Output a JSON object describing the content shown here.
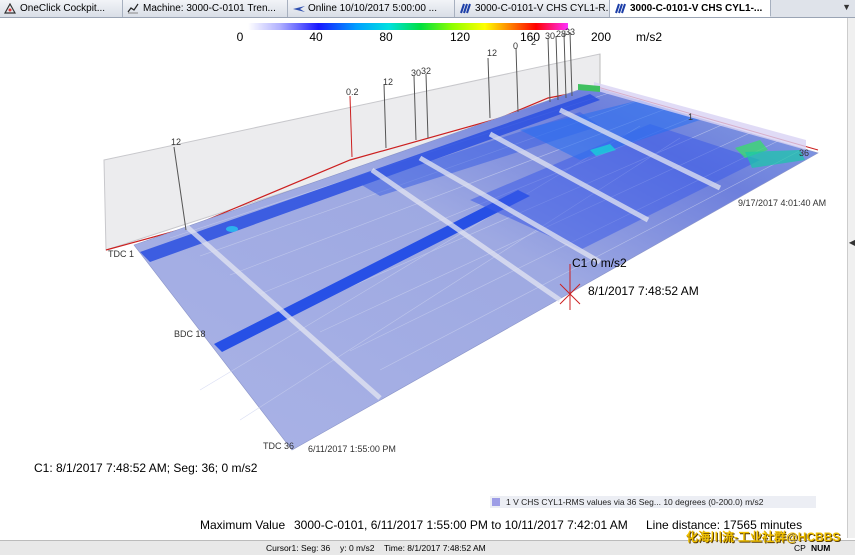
{
  "tabs": [
    {
      "label": "OneClick Cockpit...",
      "icon": "cockpit-icon"
    },
    {
      "label": "Machine: 3000-C-0101 Tren...",
      "icon": "trend-chart-icon"
    },
    {
      "label": "Online 10/10/2017 5:00:00 ...",
      "icon": "online-plane-icon"
    },
    {
      "label": "3000-C-0101-V CHS CYL1-R...",
      "icon": "waterfall-plot-icon"
    },
    {
      "label": "3000-C-0101-V CHS CYL1-...",
      "icon": "waterfall-plot-icon",
      "active": true
    }
  ],
  "tab_close": "×",
  "tab_menu": "▼",
  "color_scale": {
    "ticks": [
      "0",
      "40",
      "80",
      "120",
      "160",
      "200"
    ],
    "unit": "m/s2"
  },
  "axis": {
    "tdc_start": "TDC 1",
    "bdc": "BDC 18",
    "tdc_end": "TDC 36",
    "segment_end": "36",
    "segment_start": "1",
    "time_start": "6/11/2017 1:55:00 PM",
    "time_end": "9/17/2017 4:01:40 AM"
  },
  "cursor": {
    "tag": "C1",
    "tag_value": "0 m/s2",
    "time": "8/1/2017 7:48:52 AM",
    "readout": "C1: 8/1/2017 7:48:52 AM; Seg: 36; 0 m/s2"
  },
  "peak_labels": [
    "12",
    "0.2",
    "12",
    "30",
    "32",
    "12",
    "0",
    "2",
    "30",
    "28",
    "33"
  ],
  "legend": "1 V CHS CYL1-RMS values via 36 Seg... 10 degrees (0-200.0) m/s2",
  "max_value": {
    "label": "Maximum Value",
    "range": "3000-C-0101, 6/11/2017 1:55:00 PM to 10/11/2017 7:42:01 AM",
    "line_distance": "Line distance: 17565 minutes"
  },
  "status": {
    "cursor": "Cursor1: Seg: 36",
    "y": "y: 0 m/s2",
    "time": "Time: 8/1/2017 7:48:52 AM",
    "num": "NUM",
    "cap": "CP"
  },
  "watermark": "化海川流-工业社群@HCBBS",
  "colors": {
    "accent_red": "#cc2020",
    "band_blue": "#1a4fd8",
    "surface": "#b8c2e8"
  }
}
